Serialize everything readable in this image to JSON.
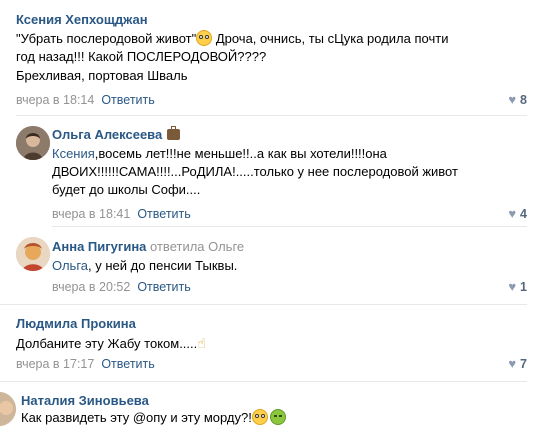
{
  "comments": [
    {
      "author": "Ксения Хепхощджан",
      "lines": [
        "\"Убрать послеродовой живот\"",
        " Дроча, очнись, ты сЦука родила почти",
        "год назад!!! Какой ПОСЛЕРОДОВОЙ????",
        "Брехливая, портовая Шваль"
      ],
      "time": "вчера в 18:14",
      "reply_label": "Ответить",
      "likes": "8"
    },
    {
      "author": "Ольга Алексеева",
      "mention": "Ксения",
      "lines": [
        ",восемь лет!!!не меньше!!..а как вы хотели!!!!она",
        "ДВОИХ!!!!!!САМА!!!!...РоДИЛА!.....только у нее послеродовой живот",
        "будет до школы Софи...."
      ],
      "time": "вчера в 18:41",
      "reply_label": "Ответить",
      "likes": "4"
    },
    {
      "author": "Анна Пигугина",
      "replied_to": "ответила Ольге",
      "mention": "Ольга",
      "lines": [
        ", у ней до пенсии Тыквы."
      ],
      "time": "вчера в 20:52",
      "reply_label": "Ответить",
      "likes": "1"
    },
    {
      "author": "Людмила Прокина",
      "lines": [
        "Долбаните эту Жабу током....."
      ],
      "time": "вчера в 17:17",
      "reply_label": "Ответить",
      "likes": "7"
    },
    {
      "author": "Наталия Зиновьева",
      "lines": [
        "Как развидеть эту @опу и эту морду?!"
      ]
    }
  ],
  "icons": {
    "like": "heart-icon",
    "emoji_flushed": "flushed-face-emoji",
    "emoji_sick": "nauseated-face-emoji",
    "badge": "briefcase-icon",
    "hand": "pointing-up-hand-emoji"
  },
  "colors": {
    "link": "#2a5885",
    "meta": "#939393",
    "divider": "#e7e8ec"
  }
}
